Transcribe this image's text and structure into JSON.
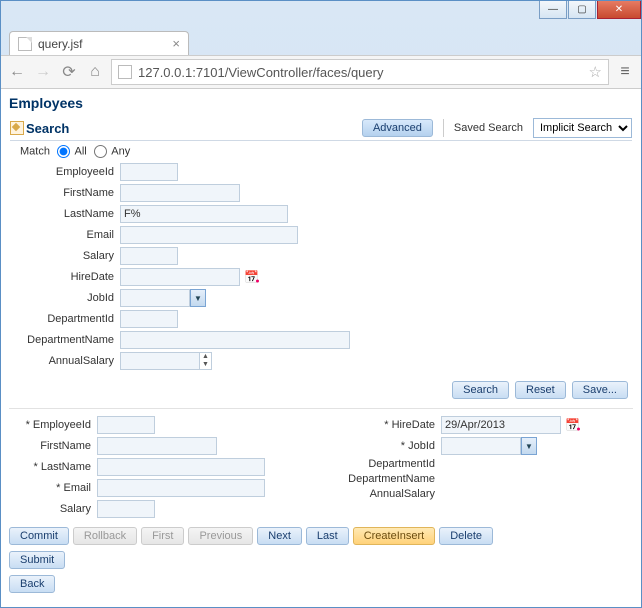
{
  "window": {
    "tab_title": "query.jsf",
    "url": "127.0.0.1:7101/ViewController/faces/query"
  },
  "page": {
    "title": "Employees",
    "panel_title": "Search",
    "advanced_btn": "Advanced",
    "saved_search_label": "Saved Search",
    "saved_search_value": "Implicit Search"
  },
  "match": {
    "label": "Match",
    "all": "All",
    "any": "Any",
    "selected": "all"
  },
  "criteria": {
    "EmployeeId": {
      "label": "EmployeeId",
      "value": ""
    },
    "FirstName": {
      "label": "FirstName",
      "value": ""
    },
    "LastName": {
      "label": "LastName",
      "value": "F%"
    },
    "Email": {
      "label": "Email",
      "value": ""
    },
    "Salary": {
      "label": "Salary",
      "value": ""
    },
    "HireDate": {
      "label": "HireDate",
      "value": ""
    },
    "JobId": {
      "label": "JobId",
      "value": ""
    },
    "DepartmentId": {
      "label": "DepartmentId",
      "value": ""
    },
    "DepartmentName": {
      "label": "DepartmentName",
      "value": ""
    },
    "AnnualSalary": {
      "label": "AnnualSalary",
      "value": ""
    }
  },
  "actions": {
    "search": "Search",
    "reset": "Reset",
    "save": "Save..."
  },
  "detail": {
    "left": {
      "EmployeeId": {
        "label": "* EmployeeId",
        "value": ""
      },
      "FirstName": {
        "label": "FirstName",
        "value": ""
      },
      "LastName": {
        "label": "* LastName",
        "value": ""
      },
      "Email": {
        "label": "* Email",
        "value": ""
      },
      "Salary": {
        "label": "Salary",
        "value": ""
      }
    },
    "right": {
      "HireDate": {
        "label": "* HireDate",
        "value": "29/Apr/2013"
      },
      "JobId": {
        "label": "* JobId",
        "value": ""
      },
      "DepartmentId": {
        "label": "DepartmentId",
        "value": ""
      },
      "DepartmentName": {
        "label": "DepartmentName",
        "value": ""
      },
      "AnnualSalary": {
        "label": "AnnualSalary",
        "value": ""
      }
    }
  },
  "toolbar": {
    "commit": "Commit",
    "rollback": "Rollback",
    "first": "First",
    "previous": "Previous",
    "next": "Next",
    "last": "Last",
    "createInsert": "CreateInsert",
    "delete": "Delete",
    "submit": "Submit",
    "back": "Back"
  }
}
